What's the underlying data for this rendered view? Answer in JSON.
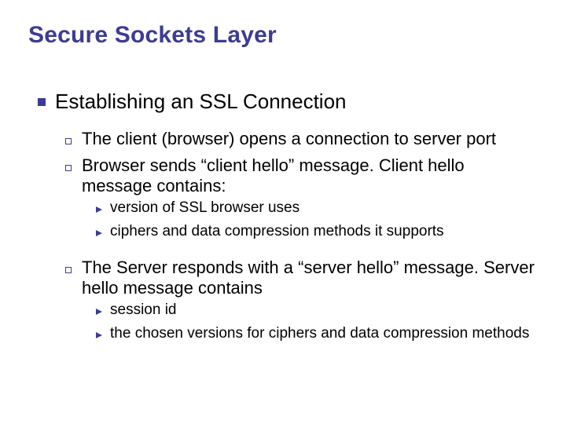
{
  "title": "Secure Sockets Layer",
  "section": "Establishing an SSL Connection",
  "points": {
    "p1": "The client (browser) opens a connection to server port",
    "p2": "Browser sends “client hello” message. Client hello message contains:",
    "p2a": "version of SSL browser uses",
    "p2b": "ciphers and data compression methods it supports",
    "p3": "The Server responds with a “server hello” message. Server hello message contains",
    "p3a": "session id",
    "p3b": "the chosen versions for ciphers and data compression methods"
  }
}
